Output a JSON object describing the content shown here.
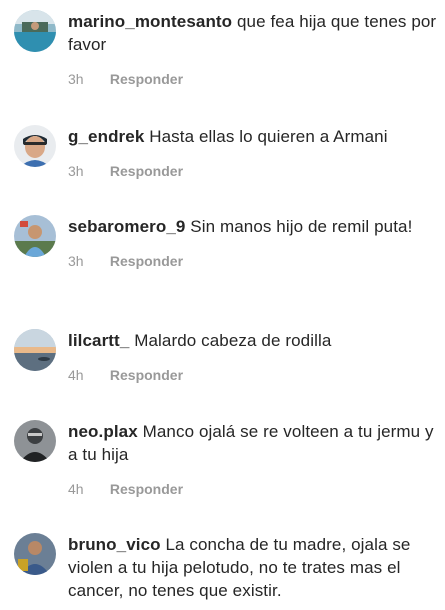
{
  "comments": [
    {
      "username": "marino_montesanto",
      "text": "que fea hija que tenes por favor",
      "time": "3h",
      "reply": "Responder",
      "avatar_icon": "avatar-pool-photo"
    },
    {
      "username": "g_endrek",
      "text": "Hasta ellas lo quieren a Armani",
      "time": "3h",
      "reply": "Responder",
      "avatar_icon": "avatar-person-photo"
    },
    {
      "username": "sebaromero_9",
      "text": "Sin manos hijo de remil puta!",
      "time": "3h",
      "reply": "Responder",
      "avatar_icon": "avatar-person-photo"
    },
    {
      "username": "lilcartt_",
      "text": "Malardo cabeza de rodilla",
      "time": "4h",
      "reply": "Responder",
      "avatar_icon": "avatar-sunset-photo"
    },
    {
      "username": "neo.plax",
      "text": "Manco ojalá se re volteen a tu jermu y a tu hija",
      "time": "4h",
      "reply": "Responder",
      "avatar_icon": "avatar-person-photo"
    },
    {
      "username": "bruno_vico",
      "text": "La concha de tu madre, ojala se violen a tu hija pelotudo, no te trates mas el cancer, no tenes que existir.",
      "time": "",
      "reply": "",
      "avatar_icon": "avatar-person-photo"
    }
  ]
}
